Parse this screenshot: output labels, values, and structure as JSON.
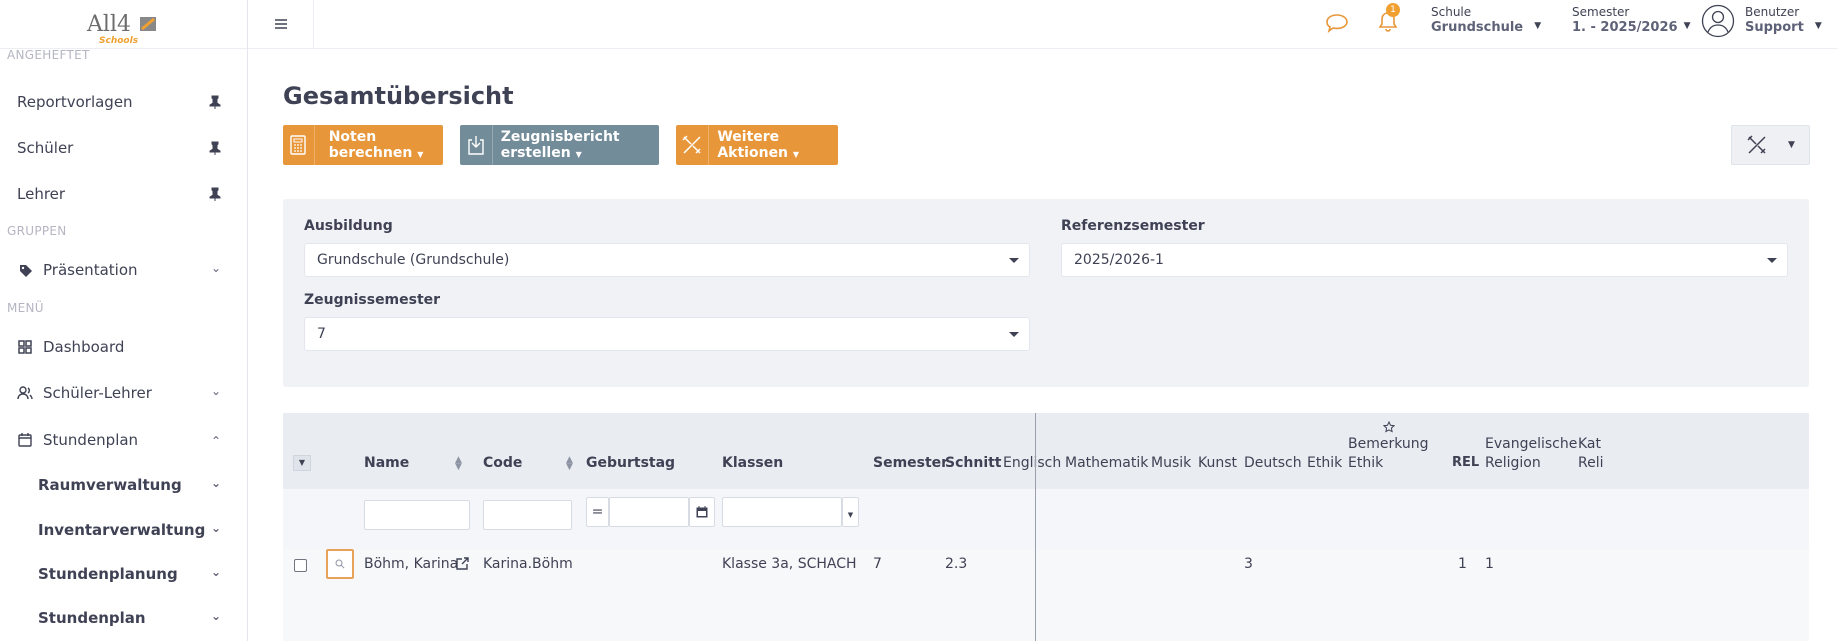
{
  "logo": {
    "text": "All4",
    "sub": "Schools"
  },
  "sidebar": {
    "pinned_label": "ANGEHEFTET",
    "pinned": [
      {
        "label": "Reportvorlagen"
      },
      {
        "label": "Schüler"
      },
      {
        "label": "Lehrer"
      }
    ],
    "groups_label": "GRUPPEN",
    "groups": [
      {
        "label": "Präsentation"
      }
    ],
    "menu_label": "MENÜ",
    "menu": [
      {
        "label": "Dashboard"
      },
      {
        "label": "Schüler-Lehrer"
      },
      {
        "label": "Stundenplan"
      }
    ],
    "submenu": [
      {
        "label": "Raumverwaltung"
      },
      {
        "label": "Inventarverwaltung"
      },
      {
        "label": "Stundenplanung"
      },
      {
        "label": "Stundenplan"
      }
    ]
  },
  "topbar": {
    "notification_count": "1",
    "school": {
      "label": "Schule",
      "value": "Grundschule"
    },
    "semester": {
      "label": "Semester",
      "value": "1. - 2025/2026"
    },
    "user": {
      "label": "Benutzer",
      "value": "Support"
    }
  },
  "page": {
    "title": "Gesamtübersicht"
  },
  "actions": {
    "calc": "Noten berechnen",
    "report": "Zeugnisbericht erstellen",
    "more": "Weitere Aktionen"
  },
  "filters": {
    "ausbildung": {
      "label": "Ausbildung",
      "value": "Grundschule (Grundschule)"
    },
    "referenz": {
      "label": "Referenzsemester",
      "value": "2025/2026-1"
    },
    "zeugnis": {
      "label": "Zeugnissemester",
      "value": "7"
    }
  },
  "table": {
    "headers": {
      "name": "Name",
      "code": "Code",
      "geburtstag": "Geburtstag",
      "klassen": "Klassen",
      "semester": "Semester",
      "schnitt": "Schnitt",
      "englisch": "Englisch",
      "mathematik": "Mathematik",
      "musik": "Musik",
      "kunst": "Kunst",
      "deutsch": "Deutsch",
      "ethik": "Ethik",
      "bem1": "Bemerkung",
      "bem2": "Ethik",
      "rel": "REL",
      "ev1": "Evangelische",
      "ev2": "Religion",
      "kat1": "Kat",
      "kat2": "Reli"
    },
    "filter_eq": "=",
    "row": {
      "name": "Böhm, Karina",
      "code": "Karina.Böhm",
      "klassen": "Klasse 3a, SCHACH",
      "semester": "7",
      "schnitt": "2.3",
      "deutsch": "3",
      "rel": "1",
      "ev": "1"
    }
  },
  "colors": {
    "accent_orange": "#e8963a",
    "accent_gray": "#738c99",
    "bell": "#f0a030"
  }
}
